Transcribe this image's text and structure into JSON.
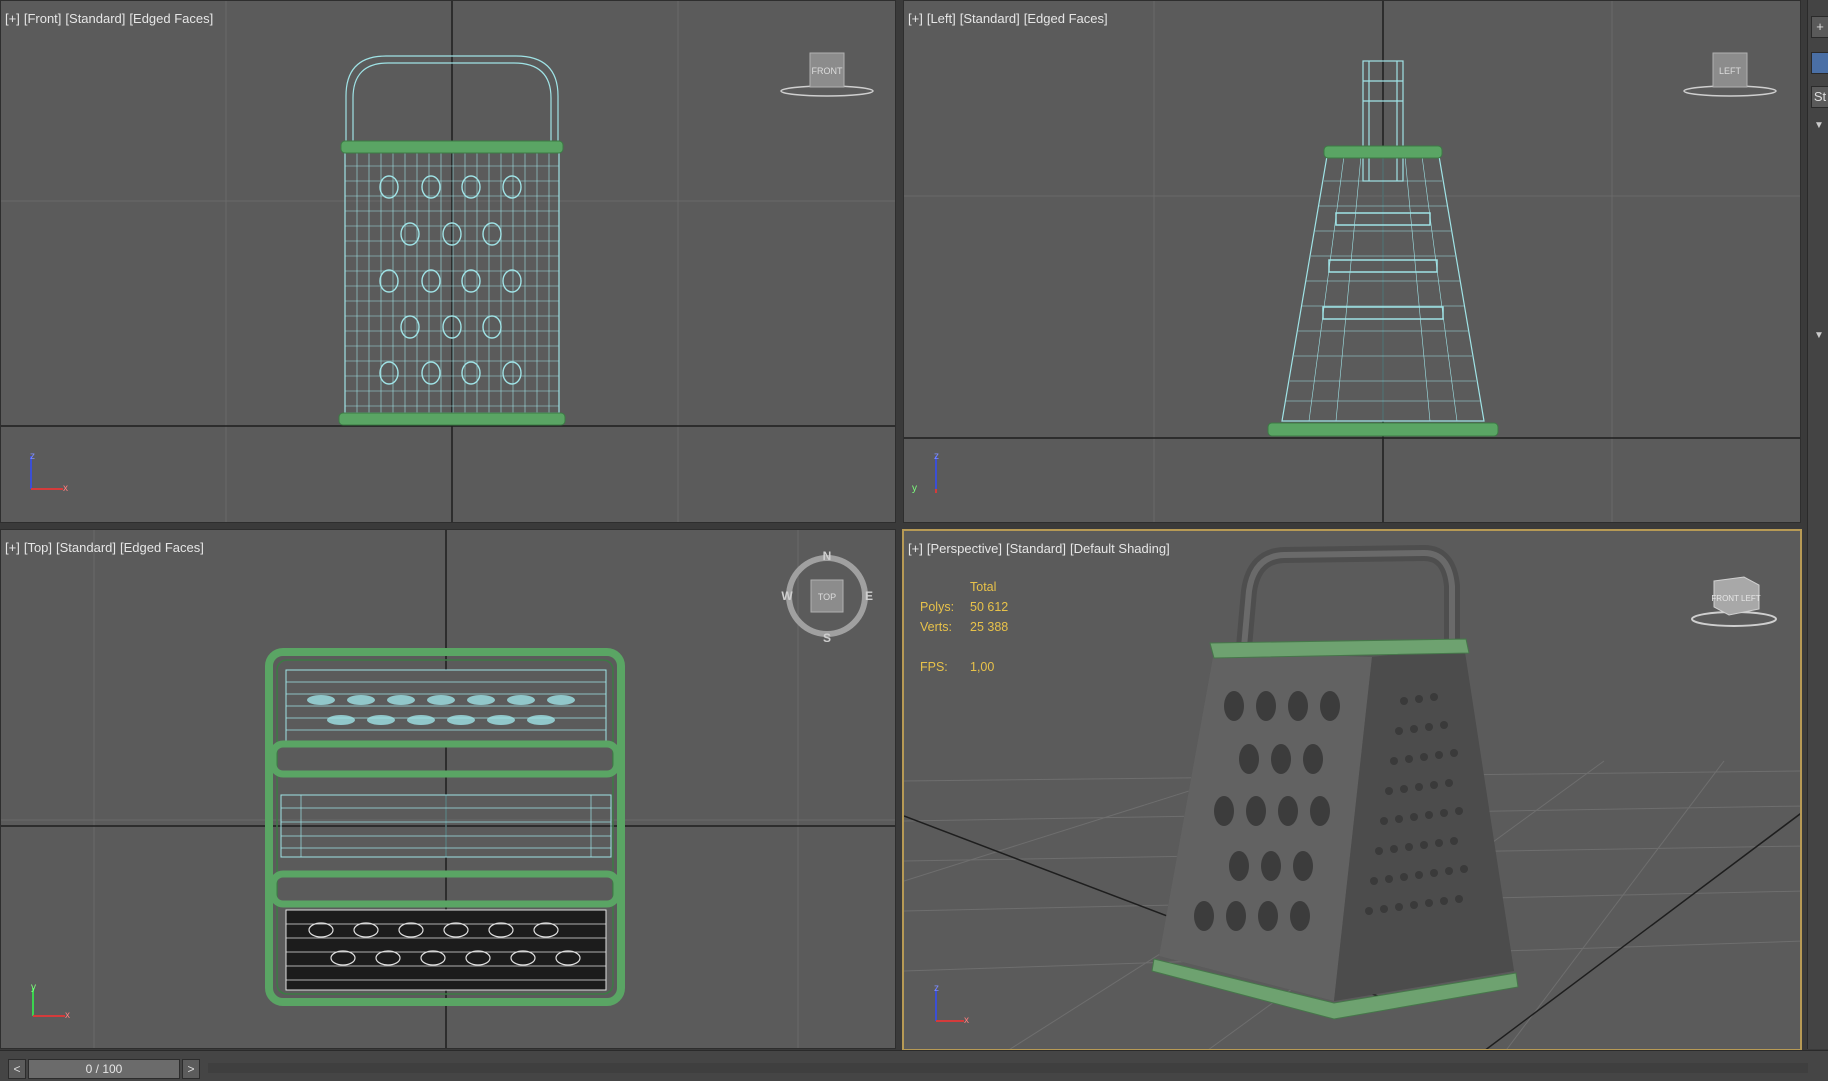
{
  "viewports": {
    "front": {
      "labels": [
        "[+]",
        "[Front]",
        "[Standard]",
        "[Edged Faces]"
      ],
      "cube": "FRONT"
    },
    "left": {
      "labels": [
        "[+]",
        "[Left]",
        "[Standard]",
        "[Edged Faces]"
      ],
      "cube": "LEFT"
    },
    "top": {
      "labels": [
        "[+]",
        "[Top]",
        "[Standard]",
        "[Edged Faces]"
      ],
      "cube": "TOP",
      "compass": {
        "n": "N",
        "s": "S",
        "e": "E",
        "w": "W"
      }
    },
    "perspective": {
      "labels": [
        "[+]",
        "[Perspective]",
        "[Standard]",
        "[Default Shading]"
      ],
      "cube": "FRONT LEFT",
      "stats": {
        "total_label": "Total",
        "polys_label": "Polys:",
        "polys_value": "50 612",
        "verts_label": "Verts:",
        "verts_value": "25 388",
        "fps_label": "FPS:",
        "fps_value": "1,00"
      }
    }
  },
  "axis": {
    "x": "x",
    "y": "y",
    "z": "z"
  },
  "timeline": {
    "prev": "<",
    "next": ">",
    "frame": "0 / 100"
  },
  "right_panel": {
    "plus": "+",
    "item": "St"
  },
  "colors": {
    "viewport_bg": "#5b5b5b",
    "wire": "#9fe3e6",
    "green": "#5aa564",
    "active_border": "#b79a55",
    "stats": "#e8c24a"
  }
}
